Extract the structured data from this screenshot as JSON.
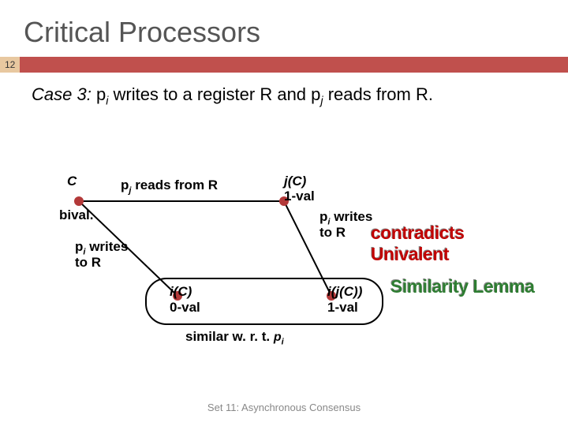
{
  "title": "Critical Processors",
  "page_number": "12",
  "case": {
    "prefix": "Case 3:  ",
    "body_a": "p",
    "sub_i": "i",
    "mid_a": " writes to a register R and p",
    "sub_j": "j",
    "tail": " reads from R."
  },
  "diagram": {
    "C": "C",
    "bival": "bival.",
    "pj_reads": "p",
    "pj_reads_sub": "j",
    "pj_reads_tail": " reads from R",
    "jC": "j(C)",
    "one_val": "1-val",
    "pi_writes": "p",
    "pi_writes_sub": "i",
    "pi_writes_tail": " writes",
    "to_R": "to R",
    "iC": "i(C)",
    "zero_val": "0-val",
    "ijC": "i(j(C))",
    "one_val2": "1-val",
    "similar_a": "similar w. r. t. ",
    "similar_b": "p",
    "similar_sub": "i"
  },
  "wordart": {
    "contradicts": "contradicts Univalent",
    "similarity": "Similarity Lemma"
  },
  "footer": "Set 11: Asynchronous Consensus"
}
